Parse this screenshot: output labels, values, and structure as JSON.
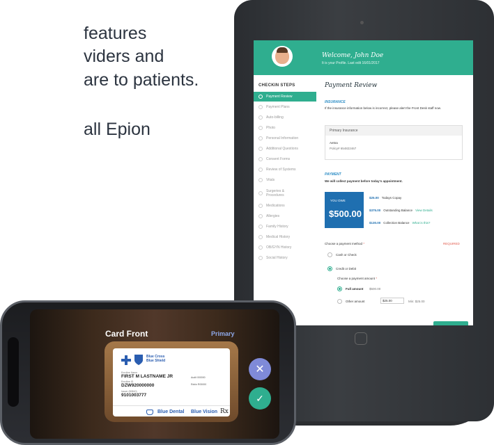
{
  "background_copy": {
    "lines": [
      "features",
      "viders and",
      "are to patients.",
      "all Epion"
    ]
  },
  "tablet": {
    "header": {
      "welcome": "Welcome, John Doe",
      "profile_sub": "It is your Profile. Last edit 16/01/2017"
    },
    "sidebar": {
      "title": "CHECKIN STEPS",
      "items": [
        "Payment Review",
        "Payment Plans",
        "Auto-billing",
        "Photo",
        "Personal Information",
        "Additional Questions",
        "Consent Forms",
        "Review of Systems",
        "Vitals",
        "Surgeries & Procedures",
        "Medications",
        "Allergies",
        "Family History",
        "Medical History",
        "OB/GYN History",
        "Social History"
      ],
      "active_index": 0
    },
    "main": {
      "title": "Payment Review",
      "insurance_heading": "INSURANCE",
      "insurance_note": "If the insurance information below is incorrect, please alert the Front Desk staff now.",
      "insurance_box_head": "Primary Insurance",
      "insurer": "Aetna",
      "policy": "Policy# 654822467",
      "payment_heading": "PAYMENT",
      "payment_note": "We will collect payment before today's appointment.",
      "due_label": "YOU OWE",
      "due_amount": "$500.00",
      "line_items": [
        {
          "amount": "$25.00",
          "label": "Todays Copay",
          "link": ""
        },
        {
          "amount": "$375.00",
          "label": "Outstanding Balance",
          "link": "View Details"
        },
        {
          "amount": "$130.00",
          "label": "Collection Balance",
          "link": "What is this?"
        }
      ],
      "method_label": "Choose a payment method",
      "required": "REQUIRED",
      "method_cash": "Cash or Check",
      "method_card": "Credit or Debit",
      "amount_label": "Choose a payment amount",
      "full_amount": "Full amount",
      "full_amount_val": "$500.00",
      "other_amount": "Other amount",
      "other_amount_val": "$25.00",
      "min_note": "Min: $25.00"
    }
  },
  "phone": {
    "card_front_label": "Card Front",
    "primary_label": "Primary",
    "card": {
      "brand": [
        "Blue Cross",
        "Blue Shield"
      ],
      "member_name_label": "Enrollee Name",
      "member_name": "FIRST M LASTNAME JR",
      "member_id_label": "Enrollee ID",
      "member_id": "DZW920000000",
      "group_label": "Issuer (80840)",
      "group": "9101003777",
      "side1": "Audit  000000",
      "side2": "Rxbin  R00000",
      "dental": "Blue Dental",
      "vision": "Blue Vision",
      "rx": "Rx"
    }
  },
  "colors": {
    "accent": "#2fae8f",
    "blue": "#1f6fb0"
  }
}
